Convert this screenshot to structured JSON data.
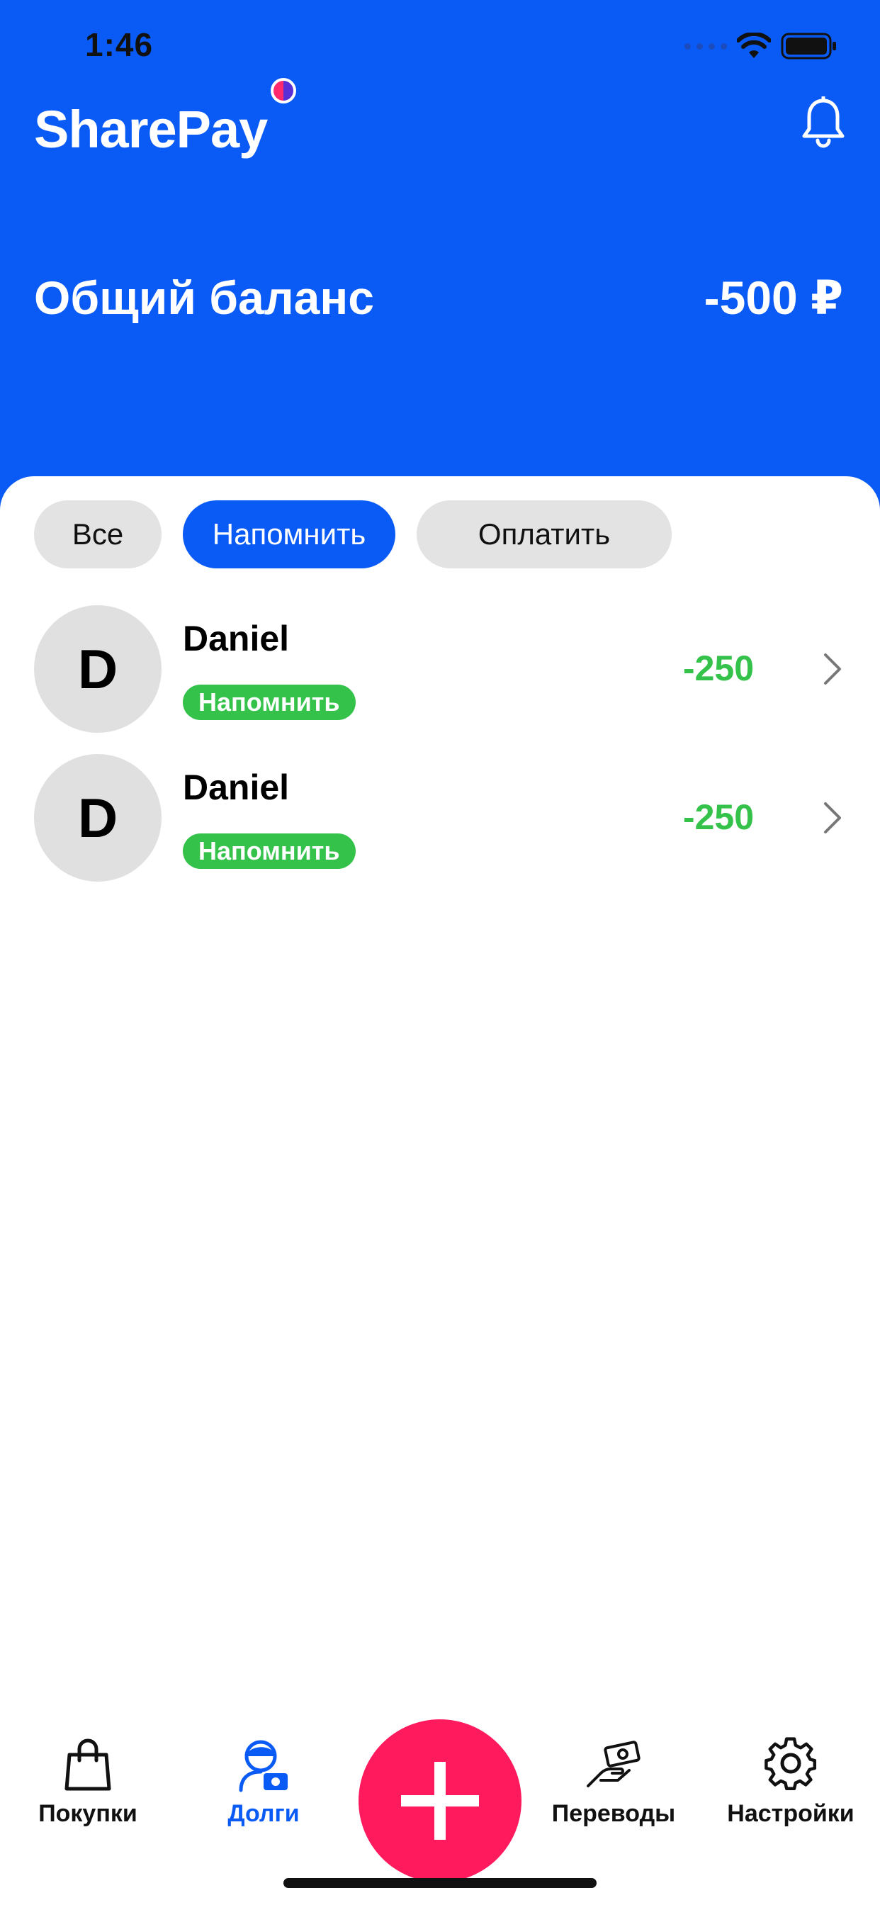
{
  "status_bar": {
    "time": "1:46"
  },
  "header": {
    "app_name": "SharePay",
    "balance_label": "Общий баланс",
    "balance_value": "-500 ₽",
    "notification_icon": "bell-icon"
  },
  "filters": [
    {
      "label": "Все",
      "active": false
    },
    {
      "label": "Напомнить",
      "active": true
    },
    {
      "label": "Оплатить",
      "active": false
    }
  ],
  "debts": [
    {
      "initial": "D",
      "name": "Daniel",
      "badge": "Напомнить",
      "amount": "-250"
    },
    {
      "initial": "D",
      "name": "Daniel",
      "badge": "Напомнить",
      "amount": "-250"
    }
  ],
  "tabbar": {
    "items": [
      {
        "label": "Покупки",
        "icon": "shopping-bag-icon",
        "active": false
      },
      {
        "label": "Долги",
        "icon": "debts-person-icon",
        "active": true
      },
      {
        "label": "Переводы",
        "icon": "transfer-hand-icon",
        "active": false
      },
      {
        "label": "Настройки",
        "icon": "gear-icon",
        "active": false
      }
    ],
    "fab_icon": "plus-icon"
  },
  "colors": {
    "primary": "#0A5BF5",
    "accent": "#FF1A5E",
    "positive": "#34C24A",
    "chip_bg": "#E3E3E3"
  }
}
